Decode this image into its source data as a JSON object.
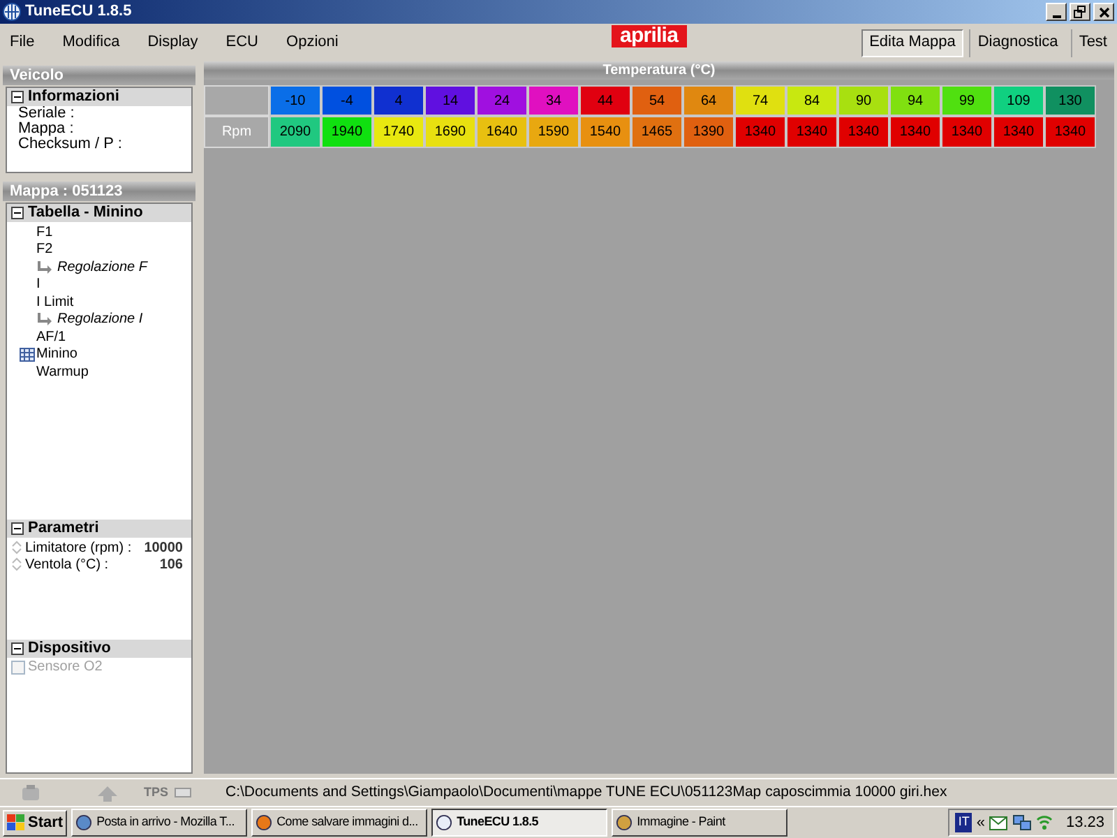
{
  "window": {
    "title": "TuneECU 1.8.5"
  },
  "menu": [
    "File",
    "Modifica",
    "Display",
    "ECU",
    "Opzioni"
  ],
  "logo": "aprilia",
  "tabs": [
    {
      "label": "Edita Mappa",
      "selected": true
    },
    {
      "label": "Diagnostica",
      "selected": false
    },
    {
      "label": "Test",
      "selected": false
    }
  ],
  "vehicle_panel": {
    "title": "Veicolo",
    "section": "Informazioni",
    "fields": [
      "Seriale :",
      "Mappa :",
      "Checksum / P :"
    ]
  },
  "map_panel": {
    "title": "Mappa : 051123",
    "section": "Tabella - Minino",
    "tree": [
      {
        "label": "F1",
        "kind": "item"
      },
      {
        "label": "F2",
        "kind": "item",
        "children": [
          {
            "label": "Regolazione F",
            "kind": "link"
          }
        ]
      },
      {
        "label": "I",
        "kind": "item"
      },
      {
        "label": "I Limit",
        "kind": "item",
        "children": [
          {
            "label": "Regolazione I",
            "kind": "link"
          }
        ]
      },
      {
        "label": "AF/1",
        "kind": "item"
      },
      {
        "label": "Minino",
        "kind": "table"
      },
      {
        "label": "Warmup",
        "kind": "item"
      }
    ],
    "parameters_section": "Parametri",
    "parameters": [
      {
        "label": "Limitatore (rpm) :",
        "value": "10000"
      },
      {
        "label": "Ventola (°C) :",
        "value": "106"
      }
    ],
    "device_section": "Dispositivo",
    "devices": [
      {
        "label": "Sensore O2",
        "checked": false,
        "disabled": true
      }
    ]
  },
  "table": {
    "title": "Temperatura (°C)",
    "row_label": "Rpm",
    "columns": [
      {
        "label": "-10",
        "color": "#0a6ee8"
      },
      {
        "label": "-4",
        "color": "#0050e0"
      },
      {
        "label": "4",
        "color": "#1030d0"
      },
      {
        "label": "14",
        "color": "#6010e0"
      },
      {
        "label": "24",
        "color": "#a010e0"
      },
      {
        "label": "34",
        "color": "#e010c0"
      },
      {
        "label": "44",
        "color": "#e00010"
      },
      {
        "label": "54",
        "color": "#e06010"
      },
      {
        "label": "64",
        "color": "#e08810"
      },
      {
        "label": "74",
        "color": "#e0e010"
      },
      {
        "label": "84",
        "color": "#c8e810"
      },
      {
        "label": "90",
        "color": "#a8e010"
      },
      {
        "label": "94",
        "color": "#80e010"
      },
      {
        "label": "99",
        "color": "#50e010"
      },
      {
        "label": "109",
        "color": "#10d080"
      },
      {
        "label": "130",
        "color": "#109060"
      }
    ],
    "values": [
      {
        "label": "2090",
        "color": "#20c880"
      },
      {
        "label": "1940",
        "color": "#10e010"
      },
      {
        "label": "1740",
        "color": "#e8e810"
      },
      {
        "label": "1690",
        "color": "#e8e010"
      },
      {
        "label": "1640",
        "color": "#e8c010"
      },
      {
        "label": "1590",
        "color": "#e8a810"
      },
      {
        "label": "1540",
        "color": "#e89010"
      },
      {
        "label": "1465",
        "color": "#e07010"
      },
      {
        "label": "1390",
        "color": "#e06010"
      },
      {
        "label": "1340",
        "color": "#e00000"
      },
      {
        "label": "1340",
        "color": "#e00000"
      },
      {
        "label": "1340",
        "color": "#e00000"
      },
      {
        "label": "1340",
        "color": "#e00000"
      },
      {
        "label": "1340",
        "color": "#e00000"
      },
      {
        "label": "1340",
        "color": "#e00000"
      },
      {
        "label": "1340",
        "color": "#e00000"
      }
    ]
  },
  "status_bar": {
    "tps_label": "TPS",
    "path": "C:\\Documents and Settings\\Giampaolo\\Documenti\\mappe TUNE ECU\\051123Map  caposcimmia 10000 giri.hex"
  },
  "taskbar": {
    "start": "Start",
    "buttons": [
      {
        "label": "Posta in arrivo - Mozilla T...",
        "selected": false
      },
      {
        "label": "Come salvare immagini d...",
        "selected": false
      },
      {
        "label": "TuneECU 1.8.5",
        "selected": true
      },
      {
        "label": "Immagine - Paint",
        "selected": false
      }
    ],
    "language": "IT",
    "chevron": "«",
    "clock": "13.23"
  }
}
